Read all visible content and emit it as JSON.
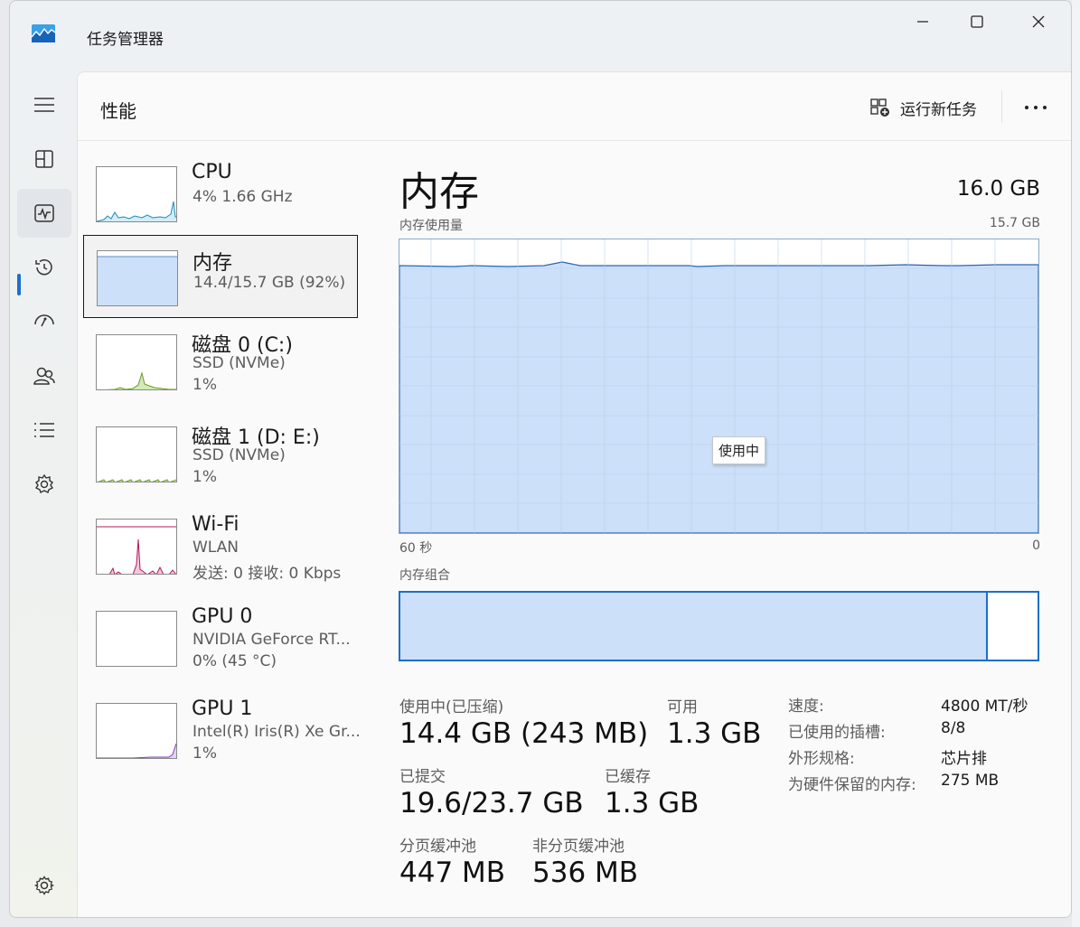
{
  "window": {
    "title": "任务管理器"
  },
  "header": {
    "page_title": "性能",
    "run_task_label": "运行新任务",
    "more_label": "···"
  },
  "sidebar_nav": [
    {
      "name": "hamburger-menu-icon",
      "active": false
    },
    {
      "name": "processes-icon",
      "active": false
    },
    {
      "name": "performance-icon",
      "active": true
    },
    {
      "name": "app-history-icon",
      "active": false
    },
    {
      "name": "startup-apps-icon",
      "active": false
    },
    {
      "name": "users-icon",
      "active": false
    },
    {
      "name": "details-icon",
      "active": false
    },
    {
      "name": "services-icon",
      "active": false
    },
    {
      "name": "settings-icon",
      "active": false
    }
  ],
  "perf_list": [
    {
      "name": "CPU",
      "sub1": "4%  1.66 GHz",
      "sub2": "",
      "selected": false,
      "color": "#1b8ab8"
    },
    {
      "name": "内存",
      "sub1": "14.4/15.7 GB (92%)",
      "sub2": "",
      "selected": true,
      "color": "#5a8cc8"
    },
    {
      "name": "磁盘 0 (C:)",
      "sub1": "SSD (NVMe)",
      "sub2": "1%",
      "selected": false,
      "color": "#6a9a2a"
    },
    {
      "name": "磁盘 1 (D: E:)",
      "sub1": "SSD (NVMe)",
      "sub2": "1%",
      "selected": false,
      "color": "#6a9a2a"
    },
    {
      "name": "Wi-Fi",
      "sub1": "WLAN",
      "sub2": "发送: 0 接收: 0 Kbps",
      "selected": false,
      "color": "#b0195a"
    },
    {
      "name": "GPU 0",
      "sub1": "NVIDIA GeForce RT...",
      "sub2": "0% (45 °C)",
      "selected": false,
      "color": "#7a3fb8"
    },
    {
      "name": "GPU 1",
      "sub1": "Intel(R) Iris(R) Xe Gr...",
      "sub2": "1%",
      "selected": false,
      "color": "#7a3fb8"
    }
  ],
  "detail": {
    "title": "内存",
    "total": "16.0 GB",
    "usage_label": "内存使用量",
    "usage_max": "15.7 GB",
    "axis_left": "60 秒",
    "axis_right": "0",
    "tooltip": "使用中",
    "composition_label": "内存组合",
    "usage_percent": 92,
    "stats": {
      "in_use_label": "使用中(已压缩)",
      "in_use_value": "14.4 GB (243 MB)",
      "available_label": "可用",
      "available_value": "1.3 GB",
      "committed_label": "已提交",
      "committed_value": "19.6/23.7 GB",
      "cached_label": "已缓存",
      "cached_value": "1.3 GB",
      "paged_label": "分页缓冲池",
      "paged_value": "447 MB",
      "nonpaged_label": "非分页缓冲池",
      "nonpaged_value": "536 MB"
    },
    "specs": [
      {
        "label": "速度:",
        "value": "4800 MT/秒"
      },
      {
        "label": "已使用的插槽:",
        "value": "8/8"
      },
      {
        "label": "外形规格:",
        "value": "芯片排"
      },
      {
        "label": "为硬件保留的内存:",
        "value": "275 MB"
      }
    ]
  },
  "colors": {
    "accent": "#1c6fd0",
    "memory_fill": "#cde0fa",
    "memory_line": "#1d6fc8"
  }
}
